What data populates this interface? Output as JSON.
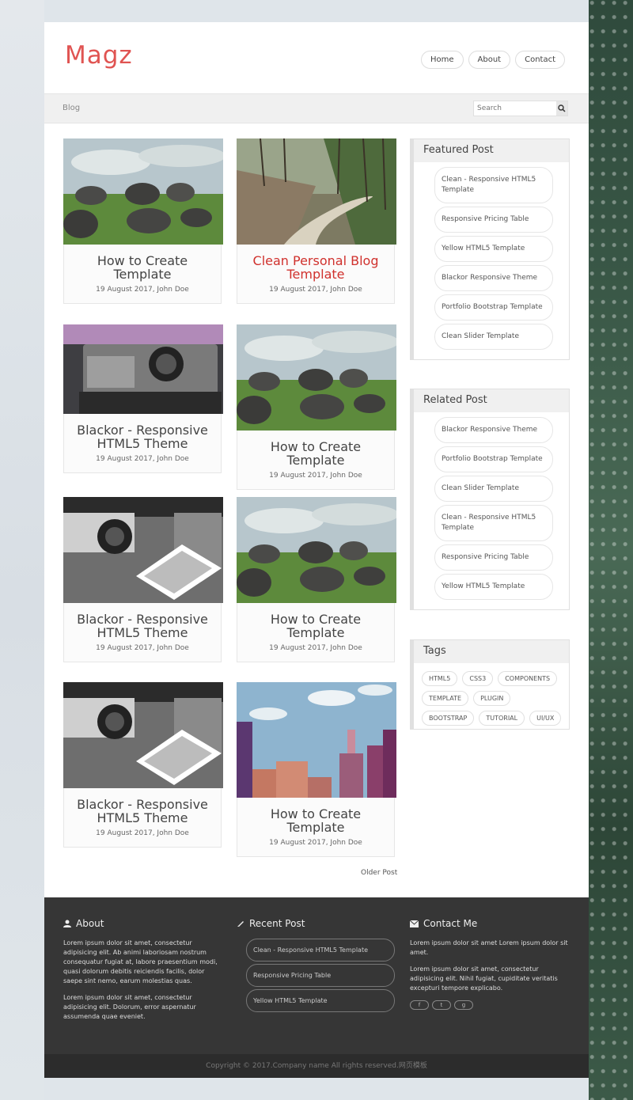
{
  "brand": {
    "logo": "Magz",
    "accent": "#e05452"
  },
  "nav": {
    "home": "Home",
    "about": "About",
    "contact": "Contact"
  },
  "breadcrumb": "Blog",
  "search": {
    "placeholder": "Search"
  },
  "posts": [
    {
      "title": "How to Create Template",
      "meta": "19 August 2017, John Doe"
    },
    {
      "title": "Clean Personal Blog Template",
      "meta": "19 August 2017, John Doe",
      "highlight": "#d0312d"
    },
    {
      "title": "Blackor - Responsive HTML5 Theme",
      "meta": "19 August 2017, John Doe"
    },
    {
      "title": "How to Create Template",
      "meta": "19 August 2017, John Doe"
    },
    {
      "title": "Blackor - Responsive HTML5 Theme",
      "meta": "19 August 2017, John Doe"
    },
    {
      "title": "How to Create Template",
      "meta": "19 August 2017, John Doe"
    },
    {
      "title": "Blackor - Responsive HTML5 Theme",
      "meta": "19 August 2017, John Doe"
    },
    {
      "title": "How to Create Template",
      "meta": "19 August 2017, John Doe"
    }
  ],
  "older_post": "Older Post",
  "featured": {
    "title": "Featured Post",
    "items": [
      "Clean - Responsive HTML5 Template",
      "Responsive Pricing Table",
      "Yellow HTML5 Template",
      "Blackor Responsive Theme",
      "Portfolio Bootstrap Template",
      "Clean Slider Template"
    ]
  },
  "related": {
    "title": "Related Post",
    "items": [
      "Blackor Responsive Theme",
      "Portfolio Bootstrap Template",
      "Clean Slider Template",
      "Clean - Responsive HTML5 Template",
      "Responsive Pricing Table",
      "Yellow HTML5 Template"
    ]
  },
  "tags": {
    "title": "Tags",
    "items": [
      "HTML5",
      "CSS3",
      "COMPONENTS",
      "TEMPLATE",
      "PLUGIN",
      "BOOTSTRAP",
      "TUTORIAL",
      "UI/UX"
    ]
  },
  "footer": {
    "about": {
      "title": "About",
      "p1": "Lorem ipsum dolor sit amet, consectetur adipisicing elit. Ab animi laboriosam nostrum consequatur fugiat at, labore praesentium modi, quasi dolorum debitis reiciendis facilis, dolor saepe sint nemo, earum molestias quas.",
      "p2": "Lorem ipsum dolor sit amet, consectetur adipisicing elit. Dolorum, error aspernatur assumenda quae eveniet."
    },
    "recent": {
      "title": "Recent Post",
      "items": [
        "Clean - Responsive HTML5 Template",
        "Responsive Pricing Table",
        "Yellow HTML5 Template"
      ]
    },
    "contact": {
      "title": "Contact Me",
      "p1": "Lorem ipsum dolor sit amet Lorem ipsum dolor sit amet.",
      "p2": "Lorem ipsum dolor sit amet, consectetur adipisicing elit. Nihil fugiat, cupiditate veritatis excepturi tempore explicabo.",
      "social": [
        "f",
        "t",
        "g"
      ]
    },
    "copyright": "Copyright © 2017.Company name All rights reserved.网页模板"
  }
}
